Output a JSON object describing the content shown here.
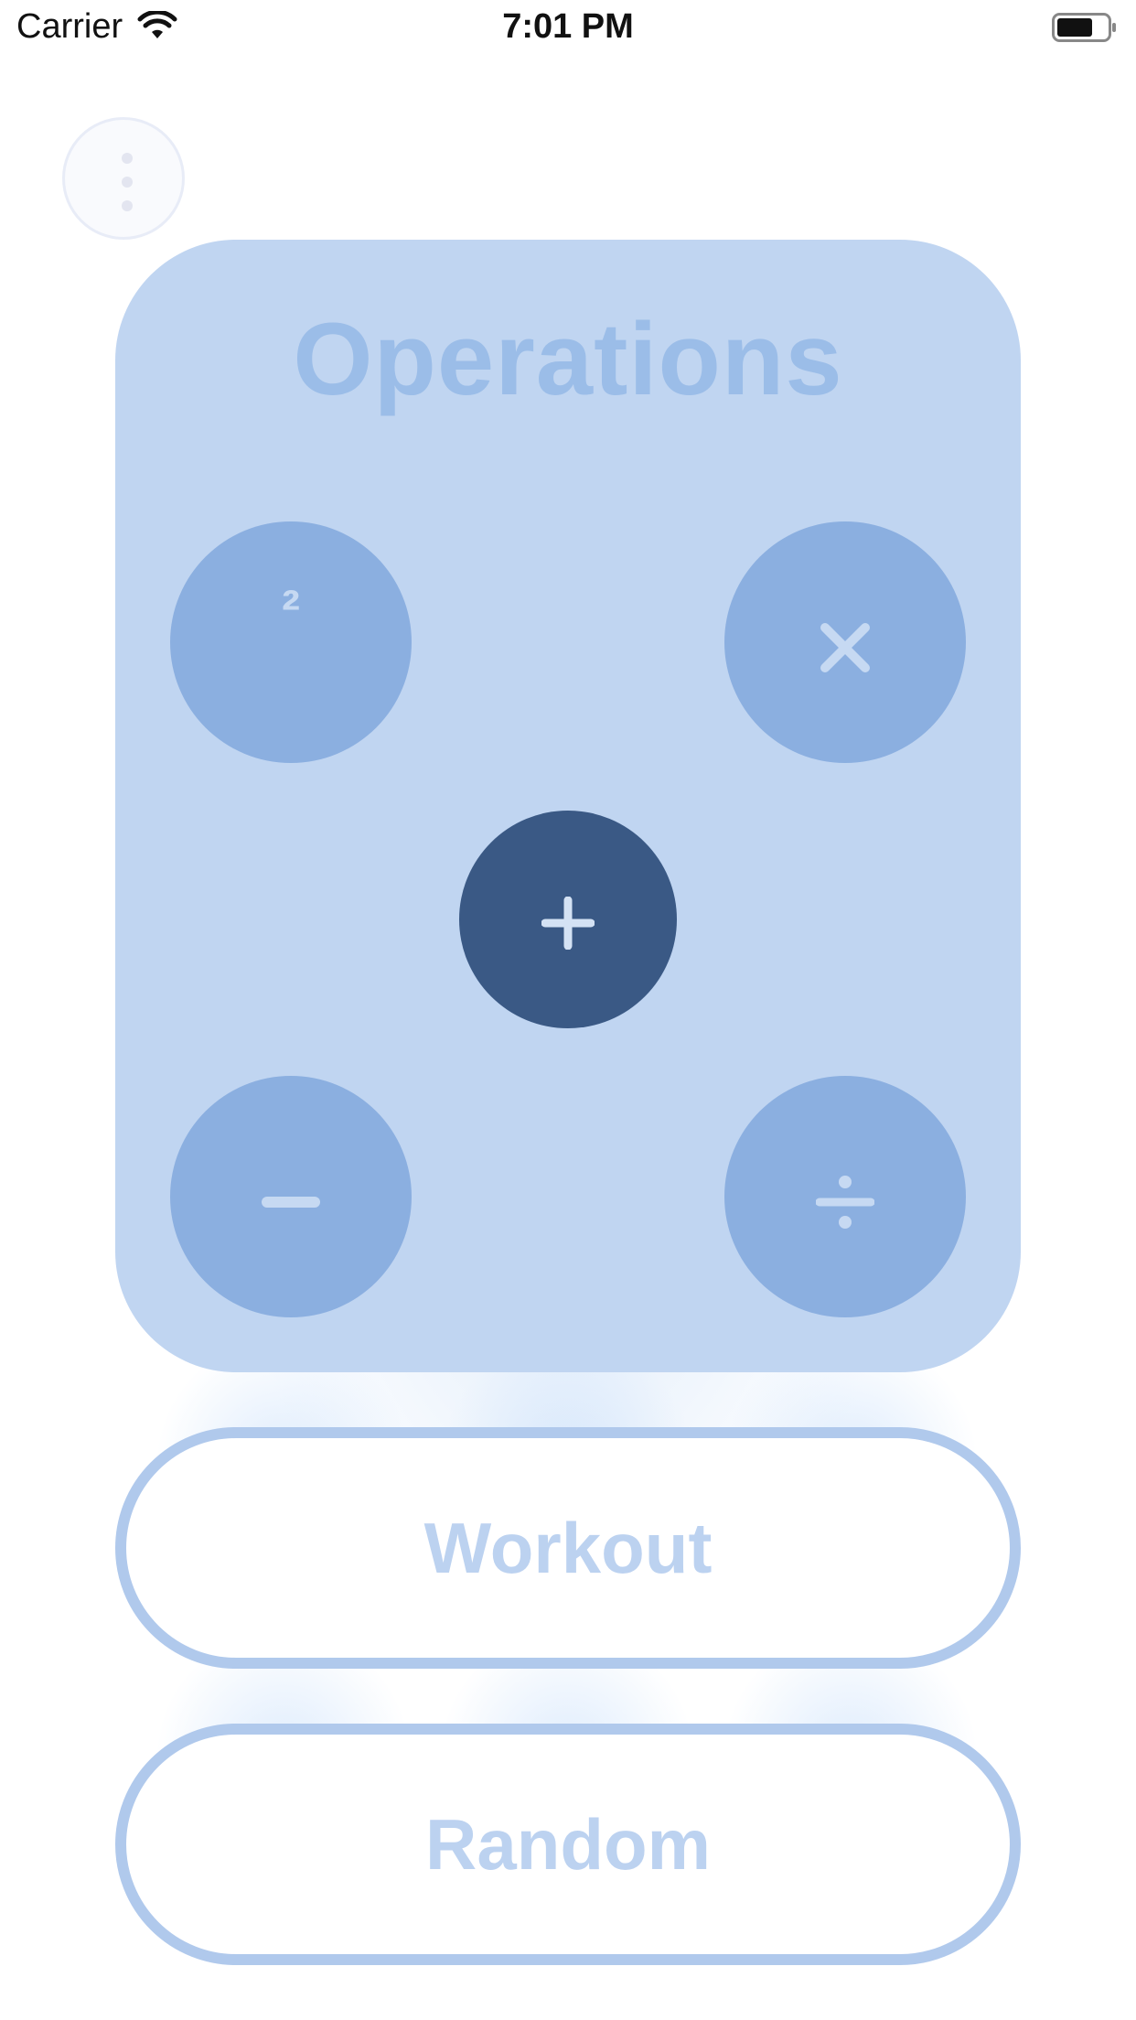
{
  "status_bar": {
    "carrier": "Carrier",
    "time": "7:01 PM"
  },
  "operations": {
    "title": "Operations",
    "buttons": {
      "square": "²",
      "multiply": "✕",
      "add": "+",
      "subtract": "−",
      "divide": "÷"
    },
    "selected": "add"
  },
  "actions": {
    "workout": "Workout",
    "random": "Random"
  },
  "colors": {
    "card_background": "#c0d5f1",
    "operation_button": "#8bafe0",
    "operation_button_selected": "#3a5985",
    "pill_border": "#b0c9ec",
    "pill_text": "#bcd2f0"
  },
  "icons": [
    "wifi-icon",
    "battery-icon",
    "more-vertical-icon"
  ]
}
